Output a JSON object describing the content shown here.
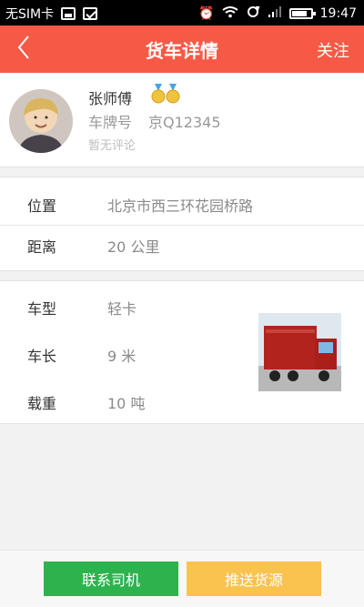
{
  "status_bar": {
    "carrier": "无SIM卡",
    "time": "19:47"
  },
  "header": {
    "title": "货车详情",
    "follow_label": "关注"
  },
  "driver": {
    "name": "张师傅",
    "plate_label": "车牌号",
    "plate": "京Q12345",
    "reviews_text": "暂无评论"
  },
  "location": {
    "position_label": "位置",
    "position_value": "北京市西三环花园桥路",
    "distance_label": "距离",
    "distance_value": "20 公里"
  },
  "truck": {
    "type_label": "车型",
    "type_value": "轻卡",
    "length_label": "车长",
    "length_value": "9 米",
    "load_label": "载重",
    "load_value": "10 吨"
  },
  "actions": {
    "contact_label": "联系司机",
    "push_label": "推送货源"
  },
  "colors": {
    "header": "#f65a46",
    "contact": "#2db34d",
    "push": "#f9c34e"
  }
}
